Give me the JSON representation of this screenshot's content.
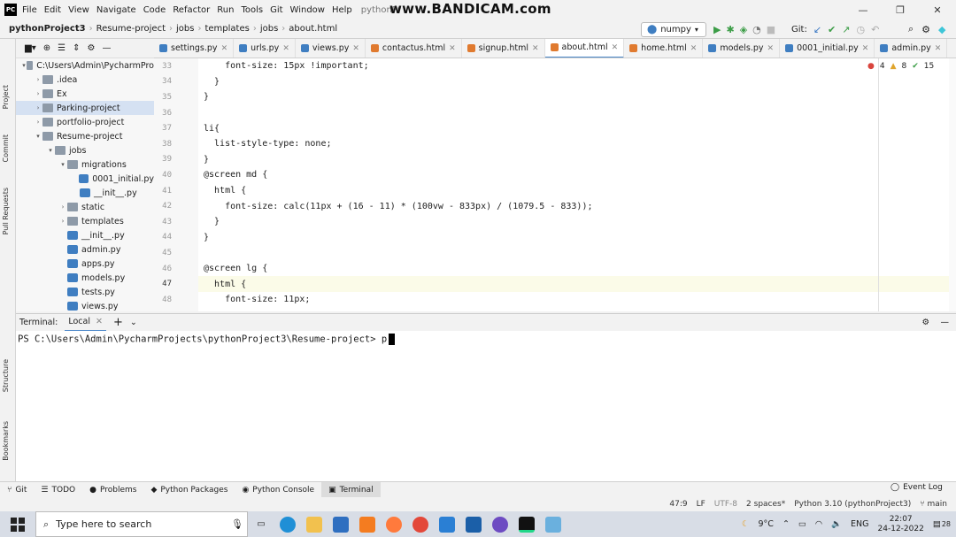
{
  "titlebar": {
    "logo": "PC",
    "menu": [
      "File",
      "Edit",
      "View",
      "Navigate",
      "Code",
      "Refactor",
      "Run",
      "Tools",
      "Git",
      "Window",
      "Help"
    ],
    "window_title": "pythonPr",
    "watermark": "www.BANDICAM.com",
    "controls": [
      "—",
      "❐",
      "✕"
    ]
  },
  "navbar": {
    "breadcrumb": [
      "pythonProject3",
      "Resume-project",
      "jobs",
      "templates",
      "jobs",
      "about.html"
    ],
    "run_config": "numpy",
    "git_label": "Git:"
  },
  "left_strip": [
    "Project",
    "Commit",
    "Pull Requests",
    "Structure",
    "Bookmarks"
  ],
  "project_tree": [
    {
      "label": "C:\\Users\\Admin\\PycharmPro",
      "type": "folder",
      "arrow": "▾",
      "indent": 0
    },
    {
      "label": ".idea",
      "type": "folder",
      "arrow": "›",
      "indent": 1
    },
    {
      "label": "Ex",
      "type": "folder",
      "arrow": "›",
      "indent": 1
    },
    {
      "label": "Parking-project",
      "type": "folder",
      "arrow": "›",
      "indent": 1,
      "selected": true
    },
    {
      "label": "portfolio-project",
      "type": "folder",
      "arrow": "›",
      "indent": 1
    },
    {
      "label": "Resume-project",
      "type": "folder",
      "arrow": "▾",
      "indent": 1
    },
    {
      "label": "jobs",
      "type": "folder",
      "arrow": "▾",
      "indent": 2
    },
    {
      "label": "migrations",
      "type": "folder",
      "arrow": "▾",
      "indent": 3
    },
    {
      "label": "0001_initial.py",
      "type": "py",
      "arrow": "",
      "indent": 4
    },
    {
      "label": "__init__.py",
      "type": "py",
      "arrow": "",
      "indent": 4
    },
    {
      "label": "static",
      "type": "folder",
      "arrow": "›",
      "indent": 3
    },
    {
      "label": "templates",
      "type": "folder",
      "arrow": "›",
      "indent": 3
    },
    {
      "label": "__init__.py",
      "type": "py",
      "arrow": "",
      "indent": 3
    },
    {
      "label": "admin.py",
      "type": "py",
      "arrow": "",
      "indent": 3
    },
    {
      "label": "apps.py",
      "type": "py",
      "arrow": "",
      "indent": 3
    },
    {
      "label": "models.py",
      "type": "py",
      "arrow": "",
      "indent": 3
    },
    {
      "label": "tests.py",
      "type": "py",
      "arrow": "",
      "indent": 3
    },
    {
      "label": "views.py",
      "type": "py",
      "arrow": "",
      "indent": 3
    }
  ],
  "tabs": [
    {
      "label": "settings.py",
      "color": "#3f7ec1"
    },
    {
      "label": "urls.py",
      "color": "#3f7ec1"
    },
    {
      "label": "views.py",
      "color": "#3f7ec1"
    },
    {
      "label": "contactus.html",
      "color": "#e07a2f"
    },
    {
      "label": "signup.html",
      "color": "#e07a2f"
    },
    {
      "label": "about.html",
      "color": "#e07a2f",
      "active": true
    },
    {
      "label": "home.html",
      "color": "#e07a2f"
    },
    {
      "label": "models.py",
      "color": "#3f7ec1"
    },
    {
      "label": "0001_initial.py",
      "color": "#3f7ec1"
    },
    {
      "label": "admin.py",
      "color": "#3f7ec1"
    }
  ],
  "inspections": {
    "errors": "4",
    "warnings": "8",
    "weak": "15"
  },
  "code_lines": [
    {
      "n": "33",
      "text": "    font-size: 15px !important;"
    },
    {
      "n": "34",
      "text": "  }"
    },
    {
      "n": "35",
      "text": "}"
    },
    {
      "n": "36",
      "text": ""
    },
    {
      "n": "37",
      "text": "li{"
    },
    {
      "n": "38",
      "text": "  list-style-type: none;"
    },
    {
      "n": "39",
      "text": "}"
    },
    {
      "n": "40",
      "text": "@screen md {"
    },
    {
      "n": "41",
      "text": "  html {"
    },
    {
      "n": "42",
      "text": "    font-size: calc(11px + (16 - 11) * (100vw - 833px) / (1079.5 - 833));"
    },
    {
      "n": "43",
      "text": "  }"
    },
    {
      "n": "44",
      "text": "}"
    },
    {
      "n": "45",
      "text": ""
    },
    {
      "n": "46",
      "text": "@screen lg {"
    },
    {
      "n": "47",
      "text": "  html {",
      "current": true
    },
    {
      "n": "48",
      "text": "    font-size: 11px;"
    }
  ],
  "terminal": {
    "label": "Terminal:",
    "tab": "Local",
    "prompt": "PS C:\\Users\\Admin\\PycharmProjects\\pythonProject3\\Resume-project> ",
    "typed": "p"
  },
  "bottom_tools": [
    {
      "label": "Git",
      "icon": "git-icon"
    },
    {
      "label": "TODO",
      "icon": "todo-icon"
    },
    {
      "label": "Problems",
      "icon": "problems-icon"
    },
    {
      "label": "Python Packages",
      "icon": "packages-icon"
    },
    {
      "label": "Python Console",
      "icon": "console-icon"
    },
    {
      "label": "Terminal",
      "icon": "terminal-icon",
      "active": true
    }
  ],
  "event_log": "Event Log",
  "status": {
    "position": "47:9",
    "line_sep": "LF",
    "encoding": "UTF-8",
    "indent": "2 spaces*",
    "interpreter": "Python 3.10 (pythonProject3)",
    "branch": "main"
  },
  "taskbar": {
    "search_placeholder": "Type here to search",
    "weather": "9°C",
    "language": "ENG",
    "time": "22:07",
    "date": "24-12-2022",
    "notifications": "28"
  }
}
